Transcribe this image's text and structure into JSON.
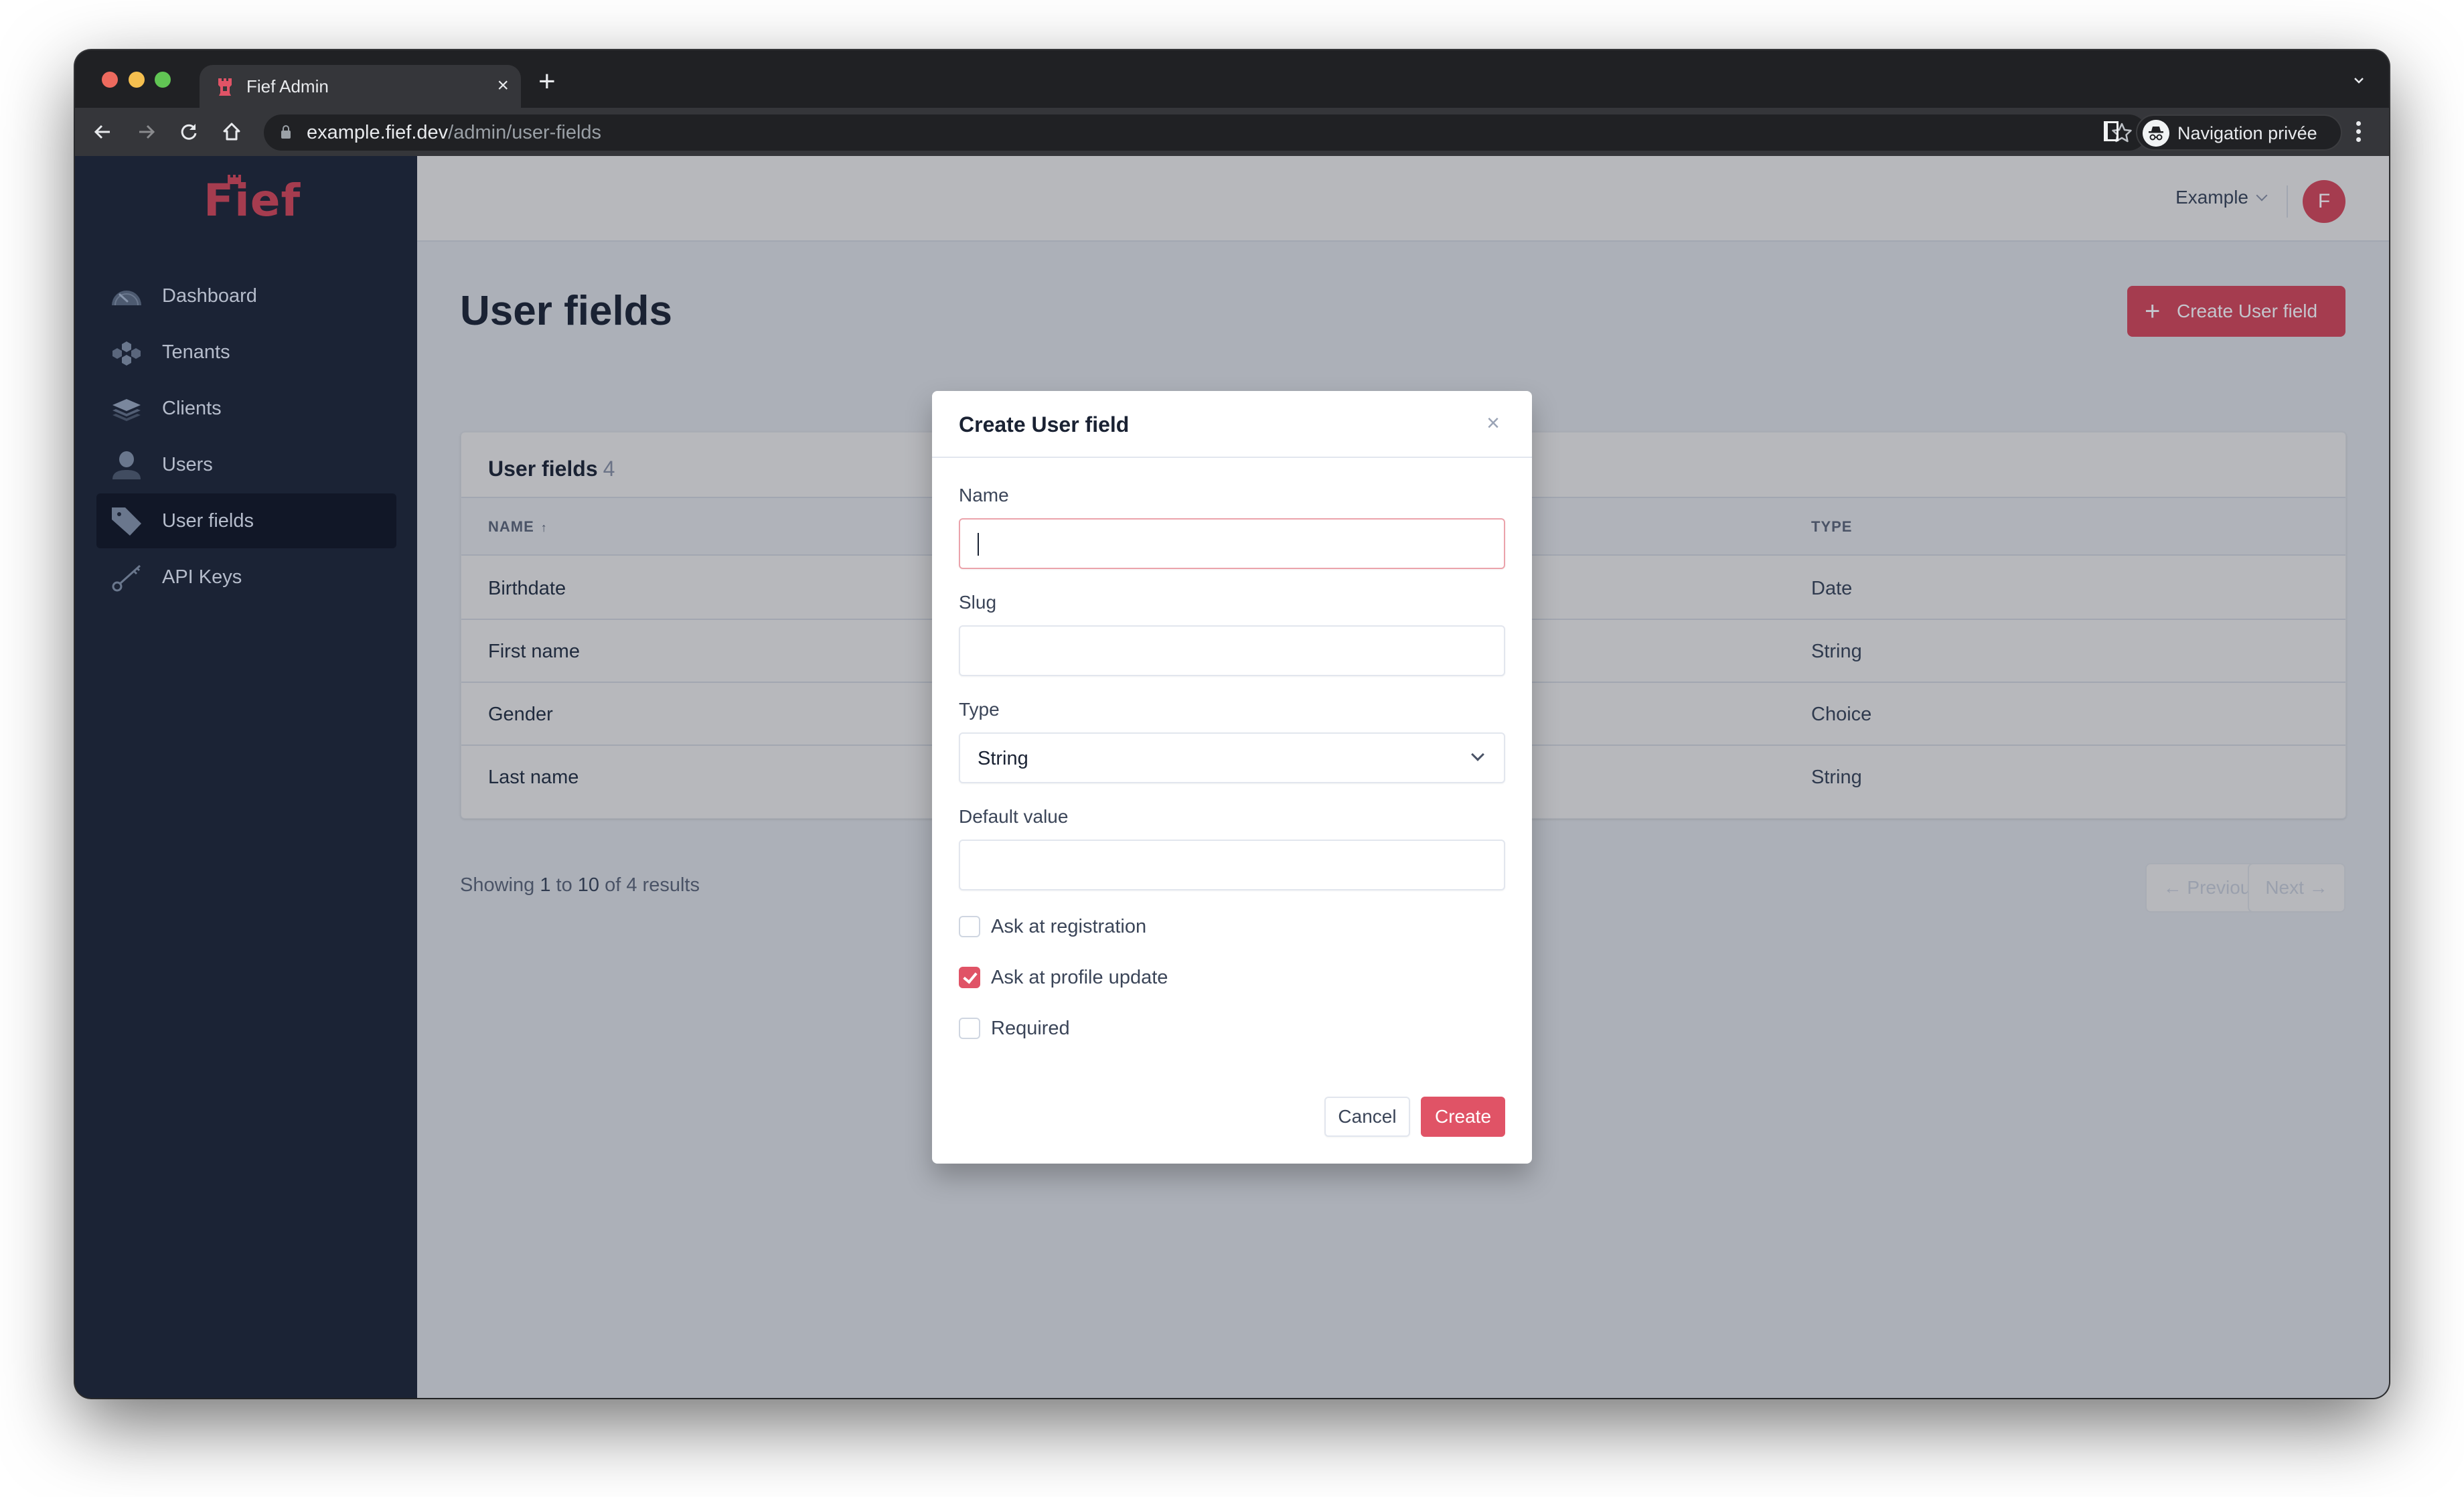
{
  "browser": {
    "tab_title": "Fief Admin",
    "tab_close": "×",
    "new_tab": "+",
    "url_host": "example.fief.dev",
    "url_path": "/admin/user-fields",
    "incognito_label": "Navigation privée"
  },
  "app": {
    "logo": "Fief",
    "brand_color": "#a53c4f",
    "accent_color": "#e05366"
  },
  "sidebar": {
    "items": [
      {
        "label": "Dashboard",
        "icon": "dashboard-gauge-icon",
        "active": false
      },
      {
        "label": "Tenants",
        "icon": "tenants-cubes-icon",
        "active": false
      },
      {
        "label": "Clients",
        "icon": "clients-layers-icon",
        "active": false
      },
      {
        "label": "Users",
        "icon": "users-person-icon",
        "active": false
      },
      {
        "label": "User fields",
        "icon": "user-fields-tag-icon",
        "active": true
      },
      {
        "label": "API Keys",
        "icon": "api-keys-key-icon",
        "active": false
      }
    ]
  },
  "header": {
    "workspace": "Example",
    "avatar_initial": "F"
  },
  "main": {
    "title": "User fields",
    "create_button": "Create User field",
    "create_button_icon": "+",
    "card_title": "User fields",
    "card_count": "4",
    "columns": {
      "name": "NAME",
      "name_sort": "↑",
      "type": "TYPE"
    },
    "rows": [
      {
        "name": "Birthdate",
        "type": "Date"
      },
      {
        "name": "First name",
        "type": "String"
      },
      {
        "name": "Gender",
        "type": "Choice"
      },
      {
        "name": "Last name",
        "type": "String"
      }
    ],
    "pagination": {
      "prefix": "Showing",
      "from": "1",
      "to_word": "to",
      "to": "10",
      "of_word": "of",
      "total": "4",
      "suffix": "results",
      "previous": "← Previous",
      "next": "Next →"
    }
  },
  "modal": {
    "title": "Create User field",
    "close": "×",
    "name_label": "Name",
    "name_value": "",
    "slug_label": "Slug",
    "slug_value": "",
    "type_label": "Type",
    "type_value": "String",
    "default_label": "Default value",
    "default_value": "",
    "checkboxes": [
      {
        "label": "Ask at registration",
        "checked": false
      },
      {
        "label": "Ask at profile update",
        "checked": true
      },
      {
        "label": "Required",
        "checked": false
      }
    ],
    "cancel": "Cancel",
    "create": "Create"
  }
}
